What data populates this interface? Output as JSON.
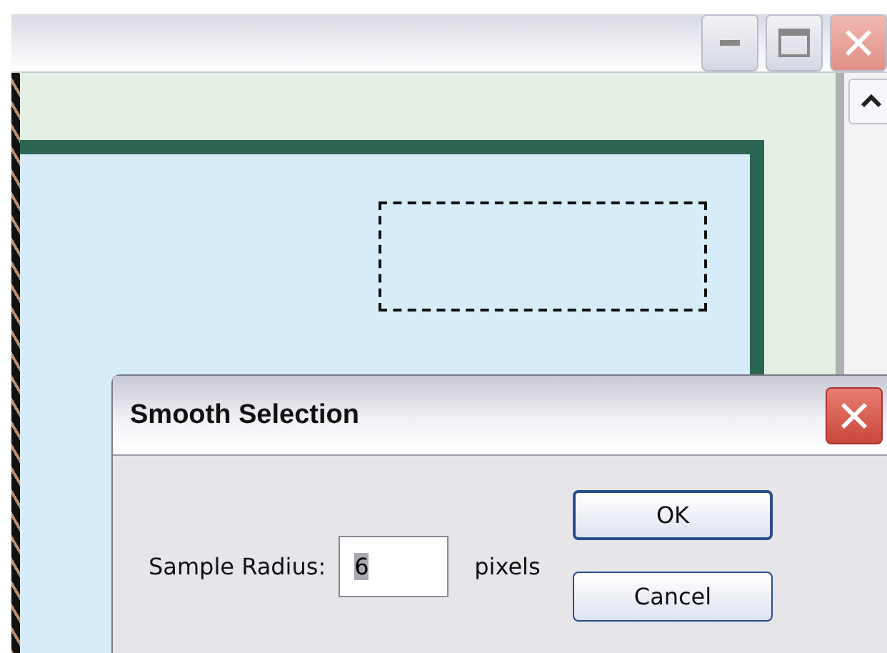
{
  "dialog": {
    "title": "Smooth Selection",
    "field": {
      "label": "Sample Radius:",
      "value": "6",
      "value_selected": true,
      "unit": "pixels"
    },
    "buttons": [
      {
        "label": "OK",
        "default": true
      },
      {
        "label": "Cancel",
        "default": false
      }
    ]
  }
}
